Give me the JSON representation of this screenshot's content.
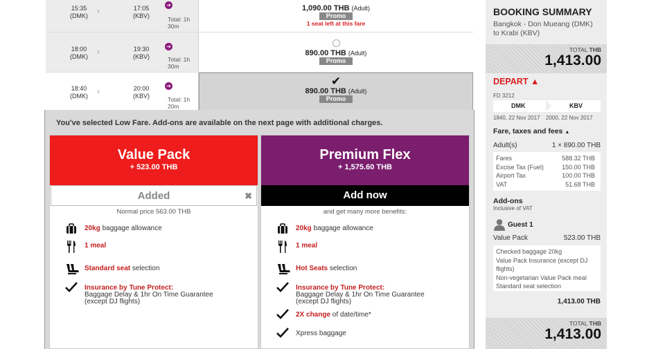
{
  "flights": [
    {
      "dep_time": "15:35",
      "dep_code": "(DMK)",
      "arr_time": "17:05",
      "arr_code": "(KBV)",
      "total": "Total: 1h 30m",
      "price": "1,090.00 THB",
      "fare_type": "(Adult)",
      "promo": "Promo",
      "warning": "1 seat left at this fare"
    },
    {
      "dep_time": "18:00",
      "dep_code": "(DMK)",
      "arr_time": "19:30",
      "arr_code": "(KBV)",
      "total": "Total: 1h 30m",
      "price": "890.00 THB",
      "fare_type": "(Adult)",
      "promo": "Promo"
    },
    {
      "dep_time": "18:40",
      "dep_code": "(DMK)",
      "arr_time": "20:00",
      "arr_code": "(KBV)",
      "total": "Total: 1h 20m",
      "price": "890.00 THB",
      "fare_type": "(Adult)",
      "promo": "Promo"
    }
  ],
  "selection_message": "You've selected Low Fare. Add-ons are available on the next page with additional charges.",
  "value_pack": {
    "name": "Value Pack",
    "price": "+ 523.00 THB",
    "button": "Added",
    "close": "✖",
    "subtext": "Normal price 563.00 THB",
    "color": "#ee1c1c",
    "benefits": [
      {
        "icon": "luggage-icon",
        "hl": "20kg",
        "text": " baggage allowance"
      },
      {
        "icon": "meal-icon",
        "hl": "1 meal",
        "text": ""
      },
      {
        "icon": "seat-icon",
        "hl": "Standard seat",
        "text": " selection"
      },
      {
        "icon": "check-icon",
        "hl": "Insurance by Tune Protect:",
        "text": "Baggage Delay & 1hr On Time Guarantee (except DJ flights)"
      }
    ]
  },
  "premium_flex": {
    "name": "Premium Flex",
    "price": "+ 1,575.60 THB",
    "button": "Add now",
    "subtext": "and get many more benefits:",
    "color": "#7b1e6e",
    "benefits": [
      {
        "icon": "luggage-icon",
        "hl": "20kg",
        "text": " baggage allowance"
      },
      {
        "icon": "meal-icon",
        "hl": "1 meal",
        "text": ""
      },
      {
        "icon": "seat-icon",
        "hl": "Hot Seats",
        "text": " selection"
      },
      {
        "icon": "check-icon",
        "hl": "Insurance by Tune Protect:",
        "text": "Baggage Delay & 1hr On Time Guarantee (except DJ flights)"
      },
      {
        "icon": "check-icon",
        "hl": "2X change",
        "text": " of date/time*"
      },
      {
        "icon": "check-icon",
        "hl": "",
        "text": "Xpress baggage"
      }
    ]
  },
  "summary": {
    "title": "BOOKING SUMMARY",
    "route": "Bangkok - Don Mueang (DMK) to Krabi (KBV)",
    "total_label": "TOTAL",
    "currency": "THB",
    "total": "1,413.00",
    "depart": "DEPART",
    "flight_no": "FD 3212",
    "from": "DMK",
    "to": "KBV",
    "from_date": "1840, 22 Nov 2017",
    "to_date": "2000, 22 Nov 2017",
    "fare_heading": "Fare, taxes and fees",
    "adult_label": "Adult(s)",
    "adult_value": "1 × 890.00 THB",
    "fees": [
      {
        "label": "Fares",
        "value": "588.32 THB"
      },
      {
        "label": "Excise Tax (Fuel)",
        "value": "150.00 THB"
      },
      {
        "label": "Airport Tax",
        "value": "100.00 THB"
      },
      {
        "label": "VAT",
        "value": "51.68 THB"
      }
    ],
    "addons_heading": "Add-ons",
    "addons_sub": "Inclusive of VAT",
    "guest": "Guest 1",
    "vp_label": "Value Pack",
    "vp_value": "523.00 THB",
    "vp_items": [
      "Checked baggage 20kg",
      "Value Pack Insurance (except DJ flights)",
      "Non-vegetarian Value Pack meal",
      "Standard seat selection"
    ],
    "guest_total": "1,413.00 THB"
  }
}
